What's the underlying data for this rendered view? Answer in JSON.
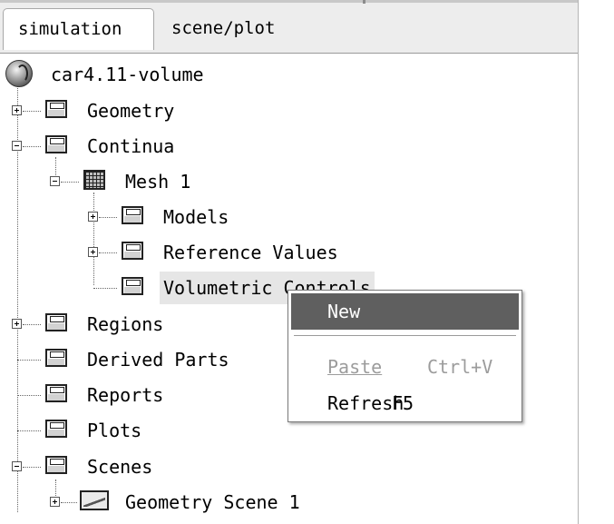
{
  "tabs": [
    {
      "label": "simulation",
      "active": true
    },
    {
      "label": "scene/plot",
      "active": false
    }
  ],
  "tree": {
    "root": {
      "label": "car4.11-volume",
      "icon": "globe-icon"
    },
    "items": [
      {
        "label": "Geometry",
        "expander": "plus",
        "icon": "folder-icon"
      },
      {
        "label": "Continua",
        "expander": "minus",
        "icon": "folder-icon"
      },
      {
        "label": "Mesh 1",
        "expander": "minus",
        "icon": "mesh-icon"
      },
      {
        "label": "Models",
        "expander": "plus",
        "icon": "folder-icon"
      },
      {
        "label": "Reference Values",
        "expander": "plus",
        "icon": "folder-icon"
      },
      {
        "label": "Volumetric Controls",
        "expander": "none",
        "icon": "folder-icon",
        "selected": true
      },
      {
        "label": "Regions",
        "expander": "plus",
        "icon": "folder-icon"
      },
      {
        "label": "Derived Parts",
        "expander": "none",
        "icon": "folder-icon"
      },
      {
        "label": "Reports",
        "expander": "none",
        "icon": "folder-icon"
      },
      {
        "label": "Plots",
        "expander": "none",
        "icon": "folder-icon"
      },
      {
        "label": "Scenes",
        "expander": "minus",
        "icon": "folder-icon"
      },
      {
        "label": "Geometry Scene 1",
        "expander": "plus",
        "icon": "scene-icon"
      }
    ]
  },
  "context_menu": {
    "items": [
      {
        "label": "New",
        "shortcut": "",
        "state": "highlighted"
      },
      {
        "label": "Paste",
        "shortcut": "Ctrl+V",
        "state": "disabled"
      },
      {
        "label": "Refresh",
        "shortcut": "F5",
        "state": "enabled"
      }
    ]
  }
}
